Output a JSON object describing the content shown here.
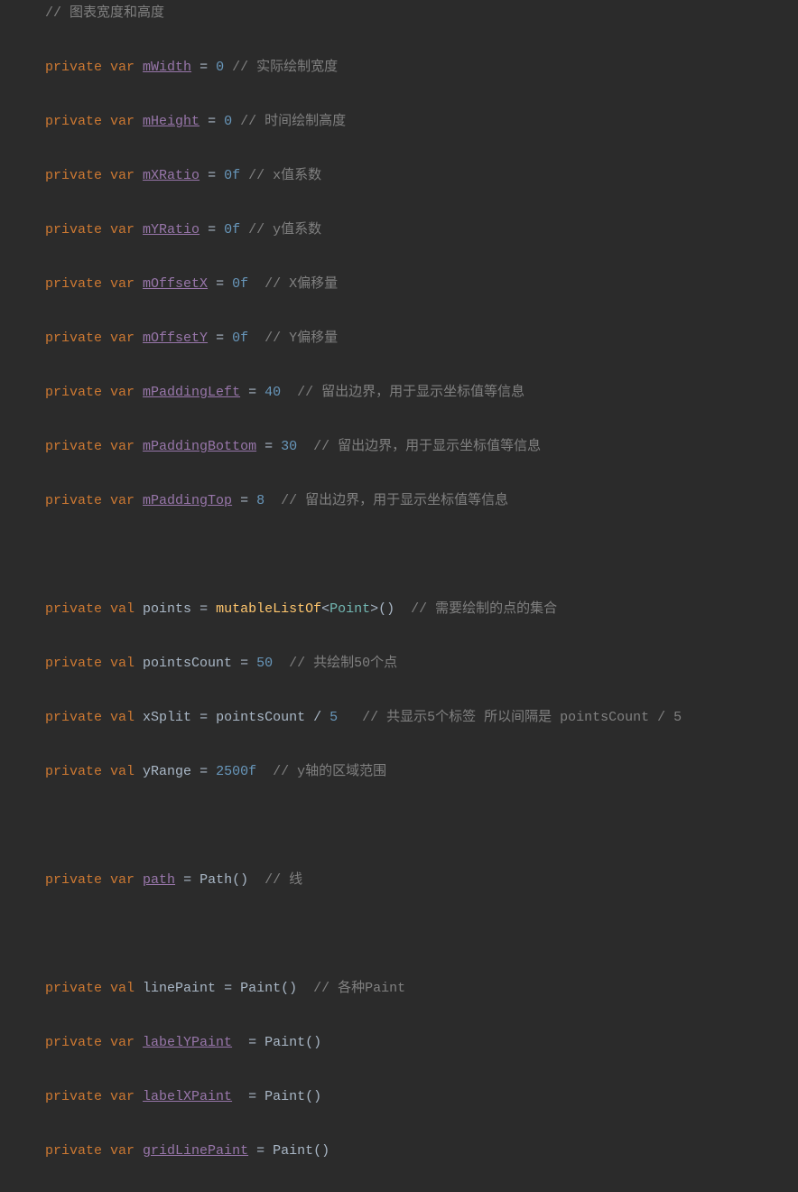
{
  "l0": {
    "c1": "//"
  },
  "lc0": " 图表宽度和高度",
  "l1": {
    "kw": "private var",
    "name": "mWidth",
    "eq": " = ",
    "val": "0",
    "csl": " //"
  },
  "lc1": " 实际绘制宽度",
  "l2": {
    "kw": "private var",
    "name": "mHeight",
    "eq": " = ",
    "val": "0",
    "csl": " //"
  },
  "lc2": " 时间绘制高度",
  "l3": {
    "kw": "private var",
    "name": "mXRatio",
    "eq": " = ",
    "val": "0f",
    "csl": " //"
  },
  "lc3": " x值系数",
  "l4": {
    "kw": "private var",
    "name": "mYRatio",
    "eq": " = ",
    "val": "0f",
    "csl": " //"
  },
  "lc4": " y值系数",
  "l5": {
    "kw": "private var",
    "name": "mOffsetX",
    "eq": " = ",
    "val": "0f",
    "csl": "  //"
  },
  "lc5": " X偏移量",
  "l6": {
    "kw": "private var",
    "name": "mOffsetY",
    "eq": " = ",
    "val": "0f",
    "csl": "  //"
  },
  "lc6": " Y偏移量",
  "l7": {
    "kw": "private var",
    "name": "mPaddingLeft",
    "eq": " = ",
    "val": "40",
    "csl": "  //"
  },
  "lc7": " 留出边界，用于显示坐标值等信息",
  "l8": {
    "kw": "private var",
    "name": "mPaddingBottom",
    "eq": " = ",
    "val": "30",
    "csl": "  //"
  },
  "lc8": " 留出边界，用于显示坐标值等信息",
  "l9": {
    "kw": "private var",
    "name": "mPaddingTop",
    "eq": " = ",
    "val": "8",
    "csl": "  //"
  },
  "lc9": " 留出边界，用于显示坐标值等信息",
  "l10": {
    "kw": "private val",
    "name": "points",
    "eq": " = ",
    "fn": "mutableListOf",
    "lt": "<",
    "type": "Point",
    "gt": ">()",
    "csl": "  //"
  },
  "lc10": " 需要绘制的点的集合",
  "l11": {
    "kw": "private val",
    "name": "pointsCount",
    "eq": " = ",
    "val": "50",
    "csl": "  //"
  },
  "lc11": " 共绘制50个点",
  "l12": {
    "kw": "private val",
    "name": "xSplit",
    "eq": " = ",
    "rhs": "pointsCount / ",
    "val": "5",
    "csl": "   //"
  },
  "lc12": " 共显示5个标签 所以间隔是 pointsCount / 5",
  "l13": {
    "kw": "private val",
    "name": "yRange",
    "eq": " = ",
    "val": "2500f",
    "csl": "  //"
  },
  "lc13": " y轴的区域范围",
  "l14": {
    "kw": "private var",
    "name": "path",
    "eq": " = ",
    "fn": "Path()",
    "csl": "  //"
  },
  "lc14": " 线",
  "l15": {
    "kw": "private val",
    "name": "linePaint",
    "eq": " = ",
    "fn": "Paint()",
    "csl": "  //"
  },
  "lc15": " 各种Paint",
  "l16": {
    "kw": "private var",
    "name": "labelYPaint",
    "eq": "  = ",
    "fn": "Paint()"
  },
  "l17": {
    "kw": "private var",
    "name": "labelXPaint",
    "eq": "  = ",
    "fn": "Paint()"
  },
  "l18": {
    "kw": "private var",
    "name": "gridLinePaint",
    "eq": " = ",
    "fn": "Paint()"
  }
}
